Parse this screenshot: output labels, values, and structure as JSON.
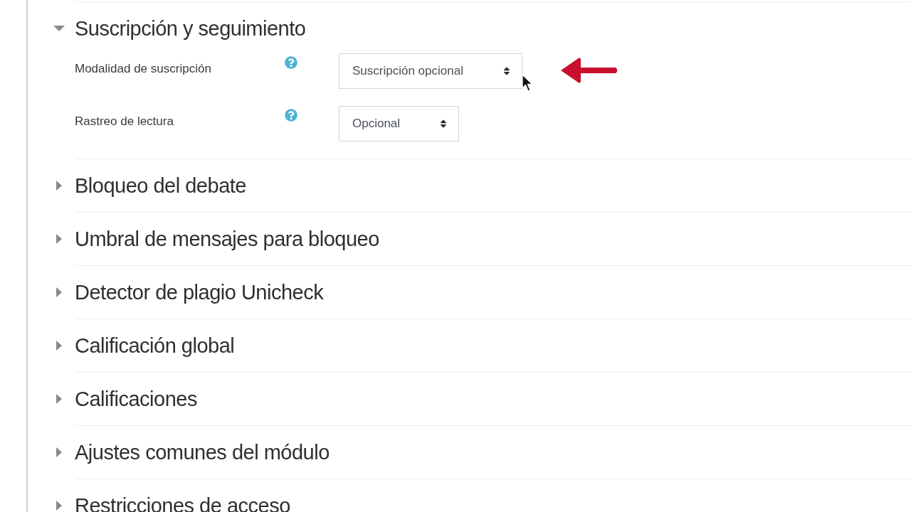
{
  "sections": [
    {
      "title": "Suscripción y seguimiento",
      "expanded": true,
      "fields": [
        {
          "label": "Modalidad de suscripción",
          "value": "Suscripción opcional"
        },
        {
          "label": "Rastreo de lectura",
          "value": "Opcional"
        }
      ]
    },
    {
      "title": "Bloqueo del debate",
      "expanded": false
    },
    {
      "title": "Umbral de mensajes para bloqueo",
      "expanded": false
    },
    {
      "title": "Detector de plagio Unicheck",
      "expanded": false
    },
    {
      "title": "Calificación global",
      "expanded": false
    },
    {
      "title": "Calificaciones",
      "expanded": false
    },
    {
      "title": "Ajustes comunes del módulo",
      "expanded": false
    },
    {
      "title": "Restricciones de acceso",
      "expanded": false
    }
  ]
}
